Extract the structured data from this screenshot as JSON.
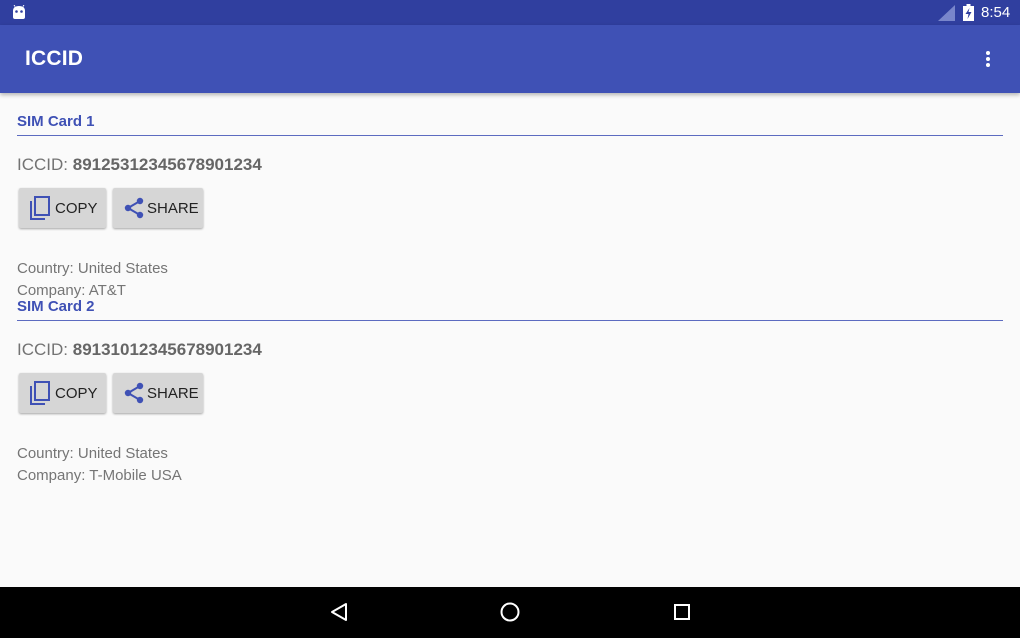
{
  "status_bar": {
    "time": "8:54",
    "icons": [
      "android-notification-icon",
      "signal-icon",
      "battery-charging-icon"
    ]
  },
  "app_bar": {
    "title": "ICCID",
    "menu_icon": "overflow-menu-icon"
  },
  "sim_cards": [
    {
      "header": "SIM Card 1",
      "iccid_label": "ICCID:",
      "iccid_value": "89125312345678901234",
      "copy_label": "COPY",
      "share_label": "SHARE",
      "country": "Country: United States",
      "company": "Company: AT&T"
    },
    {
      "header": "SIM Card 2",
      "iccid_label": "ICCID:",
      "iccid_value": "89131012345678901234",
      "copy_label": "COPY",
      "share_label": "SHARE",
      "country": "Country: United States",
      "company": "Company: T-Mobile USA"
    }
  ],
  "nav_bar": {
    "icons": [
      "back-icon",
      "home-icon",
      "recents-icon"
    ]
  },
  "colors": {
    "status_bar": "#303F9F",
    "primary": "#3F51B5",
    "background": "#FAFAFA",
    "button": "#D6D6D6",
    "nav_bar": "#000000"
  }
}
